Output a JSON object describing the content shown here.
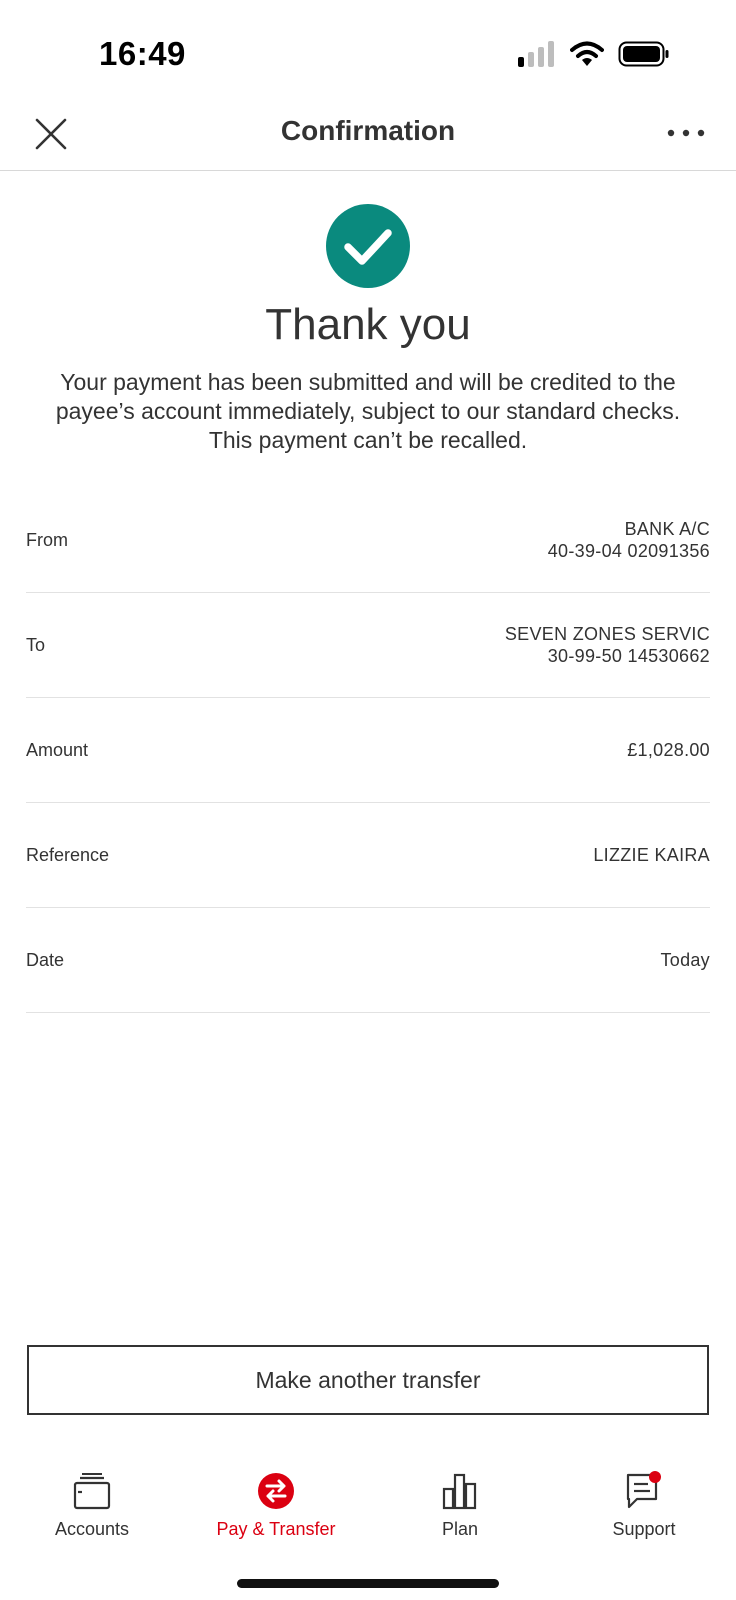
{
  "status_bar": {
    "time": "16:49"
  },
  "header": {
    "title": "Confirmation"
  },
  "confirmation": {
    "title": "Thank you",
    "message": "Your payment has been submitted and will be credited to the payee’s account immediately, subject to our standard checks. This payment can’t be recalled.",
    "accent_color": "#0a8a7e"
  },
  "details": [
    {
      "label": "From",
      "value_line1": "BANK A/C",
      "value_line2": "40-39-04 02091356"
    },
    {
      "label": "To",
      "value_line1": "SEVEN ZONES SERVIC",
      "value_line2": "30-99-50 14530662"
    },
    {
      "label": "Amount",
      "value_line1": "£1,028.00",
      "value_line2": ""
    },
    {
      "label": "Reference",
      "value_line1": "LIZZIE KAIRA",
      "value_line2": ""
    },
    {
      "label": "Date",
      "value_line1": "Today",
      "value_line2": ""
    }
  ],
  "actions": {
    "make_another_transfer": "Make another transfer"
  },
  "tab_bar": {
    "active_color": "#db0011",
    "tabs": [
      {
        "label": "Accounts",
        "icon": "wallet-icon",
        "active": false
      },
      {
        "label": "Pay & Transfer",
        "icon": "transfer-icon",
        "active": true
      },
      {
        "label": "Plan",
        "icon": "bar-chart-icon",
        "active": false
      },
      {
        "label": "Support",
        "icon": "chat-icon",
        "active": false,
        "notification": true
      }
    ]
  }
}
